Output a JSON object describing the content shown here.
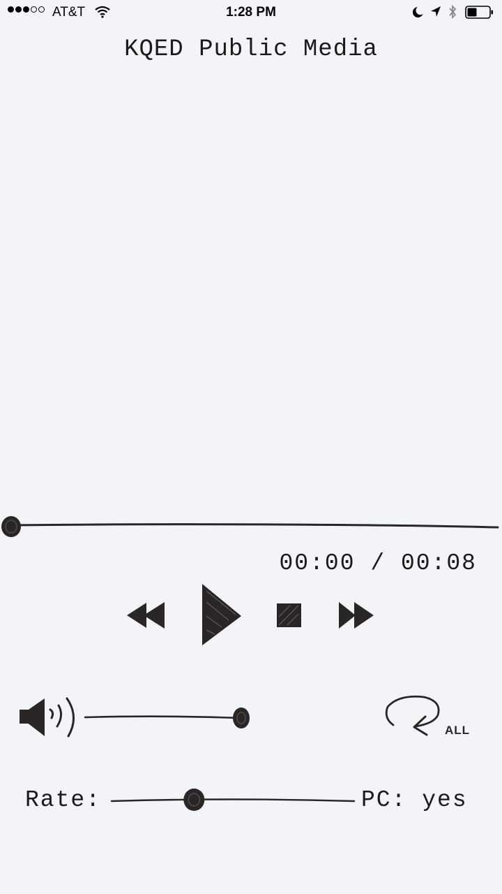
{
  "status_bar": {
    "carrier": "AT&T",
    "time": "1:28 PM",
    "signal_bars_filled": 3,
    "signal_bars_total": 5
  },
  "app": {
    "title": "KQED Public Media"
  },
  "playback": {
    "elapsed": "00:00",
    "separator": "/",
    "duration": "00:08",
    "progress_fraction": 0.0
  },
  "volume": {
    "level_fraction": 1.0
  },
  "repeat": {
    "label": "ALL"
  },
  "rate": {
    "label": "Rate:",
    "level_fraction": 0.34
  },
  "pitch_correction": {
    "label": "PC:",
    "value": "yes"
  },
  "colors": {
    "background": "#f2f4f7",
    "ink": "#2a2626"
  }
}
